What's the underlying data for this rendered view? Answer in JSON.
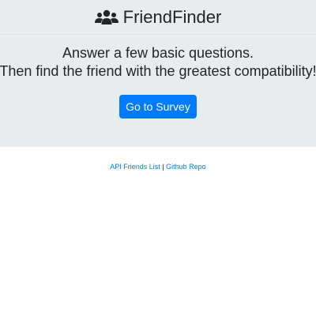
{
  "navbar": {
    "brand_icon": "users-icon",
    "brand_text": "FriendFinder"
  },
  "hero": {
    "line1": "Answer a few basic questions.",
    "line2": "Then find the friend with the greatest compatibility!",
    "cta_label": "Go to Survey"
  },
  "footer": {
    "link1": "API Friends List",
    "separator": " | ",
    "link2": "Github Repo"
  },
  "colors": {
    "header_bg": "#e9ecef",
    "primary": "#007bff",
    "text": "#212529"
  }
}
